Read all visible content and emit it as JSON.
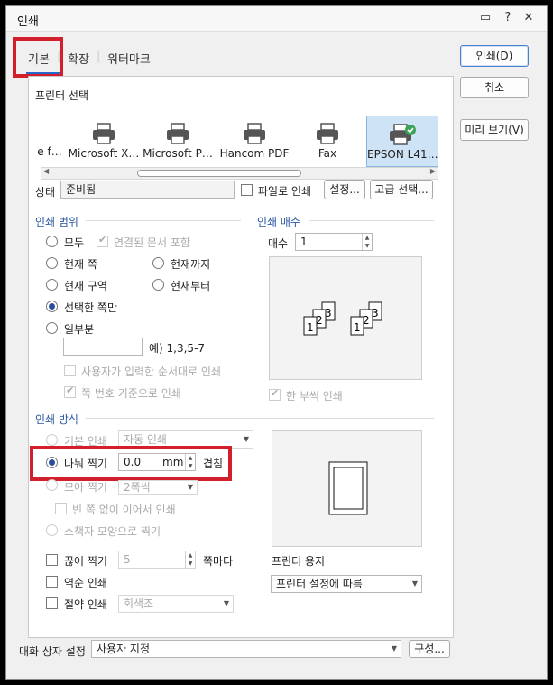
{
  "window": {
    "title": "인쇄"
  },
  "tabs": [
    "기본",
    "확장",
    "워터마크"
  ],
  "buttons": {
    "print": "인쇄(D)",
    "cancel": "취소",
    "preview": "미리 보기(V)"
  },
  "printer_select": {
    "label": "프린터 선택",
    "printers": [
      "e f…",
      "Microsoft X…",
      "Microsoft P…",
      "Hancom PDF",
      "Fax",
      "EPSON L41…"
    ],
    "selected": "EPSON L41…"
  },
  "status": {
    "label": "상태",
    "value": "준비됨",
    "print_to_file": "파일로 인쇄",
    "settings_button": "설정...",
    "advanced_button": "고급 선택..."
  },
  "print_range": {
    "title": "인쇄 범위",
    "all": "모두",
    "include_linked": "연결된 문서 포함",
    "current_page": "현재 쪽",
    "up_to_current": "현재까지",
    "current_section": "현재 구역",
    "from_current": "현재부터",
    "selected_pages": "선택한 쪽만",
    "some": "일부분",
    "example": "예) 1,3,5-7",
    "user_order": "사용자가 입력한 순서대로 인쇄",
    "page_number_based": "쪽 번호 기준으로 인쇄"
  },
  "copies": {
    "title": "인쇄 매수",
    "label": "매수",
    "value": "1",
    "collate": "한 부씩 인쇄"
  },
  "print_method": {
    "title": "인쇄 방식",
    "basic": "기본 인쇄",
    "basic_option": "자동 인쇄",
    "split": "나눠 찍기",
    "split_value": "0.0",
    "split_unit": "mm",
    "overlap": "겹침",
    "gather": "모아 찍기",
    "gather_option": "2쪽씩",
    "no_blank": "빈 쪽 없이 이어서 인쇄",
    "booklet": "소책자 모양으로 찍기"
  },
  "options": {
    "cut": "끊어 찍기",
    "cut_value": "5",
    "cut_unit": "쪽마다",
    "reverse": "역순 인쇄",
    "save": "절약 인쇄",
    "save_option": "회색조"
  },
  "paper": {
    "label": "프린터 용지",
    "value": "프린터 설정에 따름"
  },
  "footer": {
    "label": "대화 상자 설정",
    "value": "사용자 지정",
    "config_button": "구성..."
  },
  "preview_numbers": [
    "1",
    "2",
    "3"
  ],
  "colors": {
    "accent": "#2a66c9",
    "highlight": "#d21f2b",
    "selected": "#cfe3f7"
  }
}
